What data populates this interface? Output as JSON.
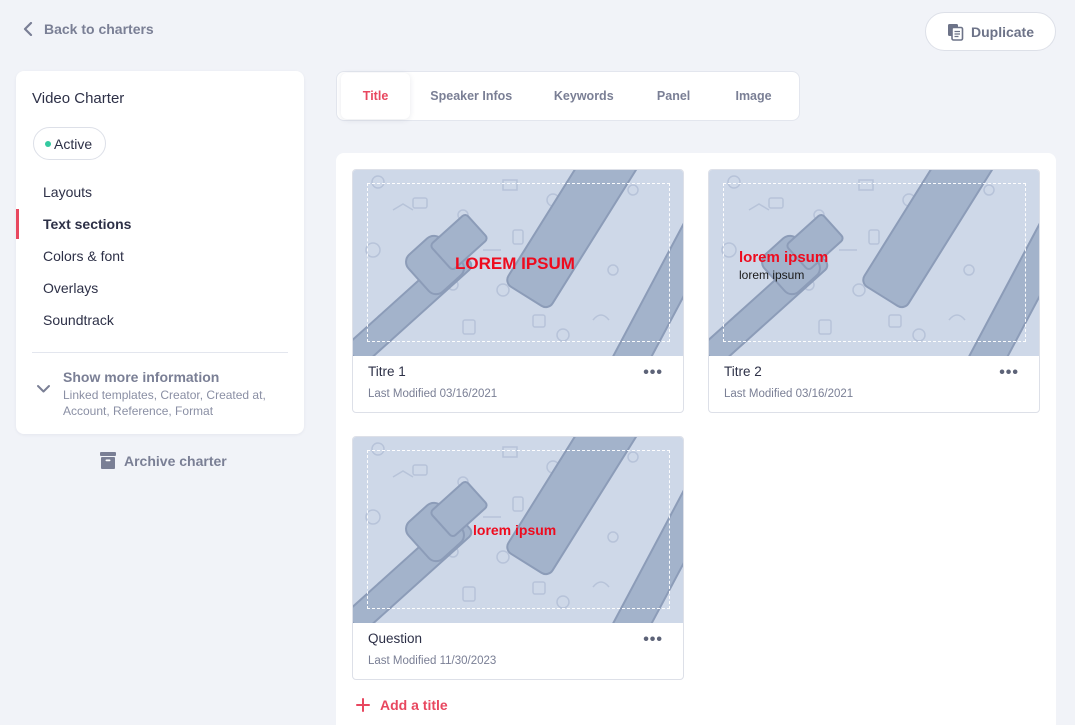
{
  "header": {
    "back_label": "Back to charters",
    "duplicate_label": "Duplicate"
  },
  "sidebar": {
    "title": "Video Charter",
    "status": "Active",
    "items": [
      {
        "label": "Layouts",
        "active": false
      },
      {
        "label": "Text sections",
        "active": true
      },
      {
        "label": "Colors & font",
        "active": false
      },
      {
        "label": "Overlays",
        "active": false
      },
      {
        "label": "Soundtrack",
        "active": false
      }
    ],
    "more_title": "Show more information",
    "more_sub": "Linked templates, Creator, Created at, Account, Reference, Format",
    "archive_label": "Archive charter"
  },
  "tabs": [
    {
      "label": "Title",
      "active": true
    },
    {
      "label": "Speaker Infos",
      "active": false
    },
    {
      "label": "Keywords",
      "active": false
    },
    {
      "label": "Panel",
      "active": false
    },
    {
      "label": "Image",
      "active": false
    }
  ],
  "cards": [
    {
      "name": "Titre 1",
      "modified": "Last Modified 03/16/2021",
      "preview_main": "LOREM IPSUM",
      "preview_sub": "",
      "menu_icon": "•••"
    },
    {
      "name": "Titre 2",
      "modified": "Last Modified 03/16/2021",
      "preview_main": "lorem ipsum",
      "preview_sub": "lorem ipsum",
      "menu_icon": "•••"
    },
    {
      "name": "Question",
      "modified": "Last Modified 11/30/2023",
      "preview_main": "lorem ipsum",
      "preview_sub": "",
      "menu_icon": "•••"
    }
  ],
  "add_title_label": "Add a title",
  "colors": {
    "accent": "#e8475f",
    "preview_text": "#ee0b1e",
    "preview_bg": "#ced8e8",
    "status_dot": "#34c9a0"
  },
  "icons": {
    "back": "chevron-left-icon",
    "duplicate": "copy-icon",
    "expand": "chevron-down-icon",
    "archive": "archive-box-icon",
    "add": "plus-icon",
    "card_menu": "more-horizontal-icon"
  }
}
